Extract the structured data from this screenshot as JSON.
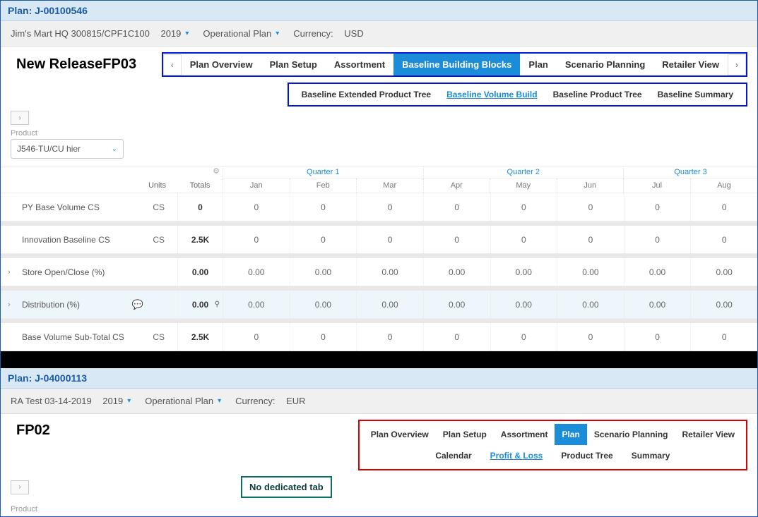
{
  "upper": {
    "plan_title": "Plan: J-00100546",
    "toolbar": {
      "customer": "Jim's Mart HQ 300815/CPF1C100",
      "year": "2019",
      "plan_type": "Operational Plan",
      "currency_label": "Currency:",
      "currency": "USD"
    },
    "banner": "New ReleaseFP03",
    "tabs": [
      "Plan Overview",
      "Plan Setup",
      "Assortment",
      "Baseline Building Blocks",
      "Plan",
      "Scenario Planning",
      "Retailer View"
    ],
    "tabs_active": "Baseline Building Blocks",
    "subtabs": [
      "Baseline Extended Product Tree",
      "Baseline Volume Build",
      "Baseline Product Tree",
      "Baseline Summary"
    ],
    "subtabs_active": "Baseline Volume Build",
    "product_label": "Product",
    "product_value": "J546-TU/CU hier",
    "grid": {
      "units_h": "Units",
      "totals_h": "Totals",
      "quarters": [
        "Quarter 1",
        "Quarter 2",
        "Quarter 3"
      ],
      "months": [
        "Jan",
        "Feb",
        "Mar",
        "Apr",
        "May",
        "Jun",
        "Jul",
        "Aug"
      ],
      "rows": [
        {
          "name": "PY Base Volume",
          "units": "CS",
          "units2": "CS",
          "total": "0",
          "cells": [
            "0",
            "0",
            "0",
            "0",
            "0",
            "0",
            "0",
            "0"
          ],
          "expand": false,
          "hl": false
        },
        {
          "name": "Innovation Baseline",
          "units": "CS",
          "units2": "CS",
          "total": "2.5K",
          "cells": [
            "0",
            "0",
            "0",
            "0",
            "0",
            "0",
            "0",
            "0"
          ],
          "expand": false,
          "hl": false
        },
        {
          "name": "Store Open/Close (%)",
          "units": "",
          "units2": "",
          "total": "0.00",
          "cells": [
            "0.00",
            "0.00",
            "0.00",
            "0.00",
            "0.00",
            "0.00",
            "0.00",
            "0.00"
          ],
          "expand": true,
          "hl": false
        },
        {
          "name": "Distribution (%)",
          "units": "",
          "units2": "",
          "total": "0.00",
          "cells": [
            "0.00",
            "0.00",
            "0.00",
            "0.00",
            "0.00",
            "0.00",
            "0.00",
            "0.00"
          ],
          "expand": true,
          "hl": true,
          "comment": true,
          "mag": true
        },
        {
          "name": "Base Volume Sub-Total",
          "units": "CS",
          "units2": "CS",
          "total": "2.5K",
          "cells": [
            "0",
            "0",
            "0",
            "0",
            "0",
            "0",
            "0",
            "0"
          ],
          "expand": false,
          "hl": false
        }
      ]
    }
  },
  "lower": {
    "plan_title": "Plan: J-04000113",
    "toolbar": {
      "customer": "RA Test 03-14-2019",
      "year": "2019",
      "plan_type": "Operational Plan",
      "currency_label": "Currency:",
      "currency": "EUR"
    },
    "banner": "FP02",
    "tabs": [
      "Plan Overview",
      "Plan Setup",
      "Assortment",
      "Plan",
      "Scenario Planning",
      "Retailer View"
    ],
    "tabs_active": "Plan",
    "subtabs": [
      "Calendar",
      "Profit & Loss",
      "Product Tree",
      "Summary"
    ],
    "subtabs_active": "Profit & Loss",
    "callout": "No dedicated tab",
    "product_label": "Product"
  }
}
